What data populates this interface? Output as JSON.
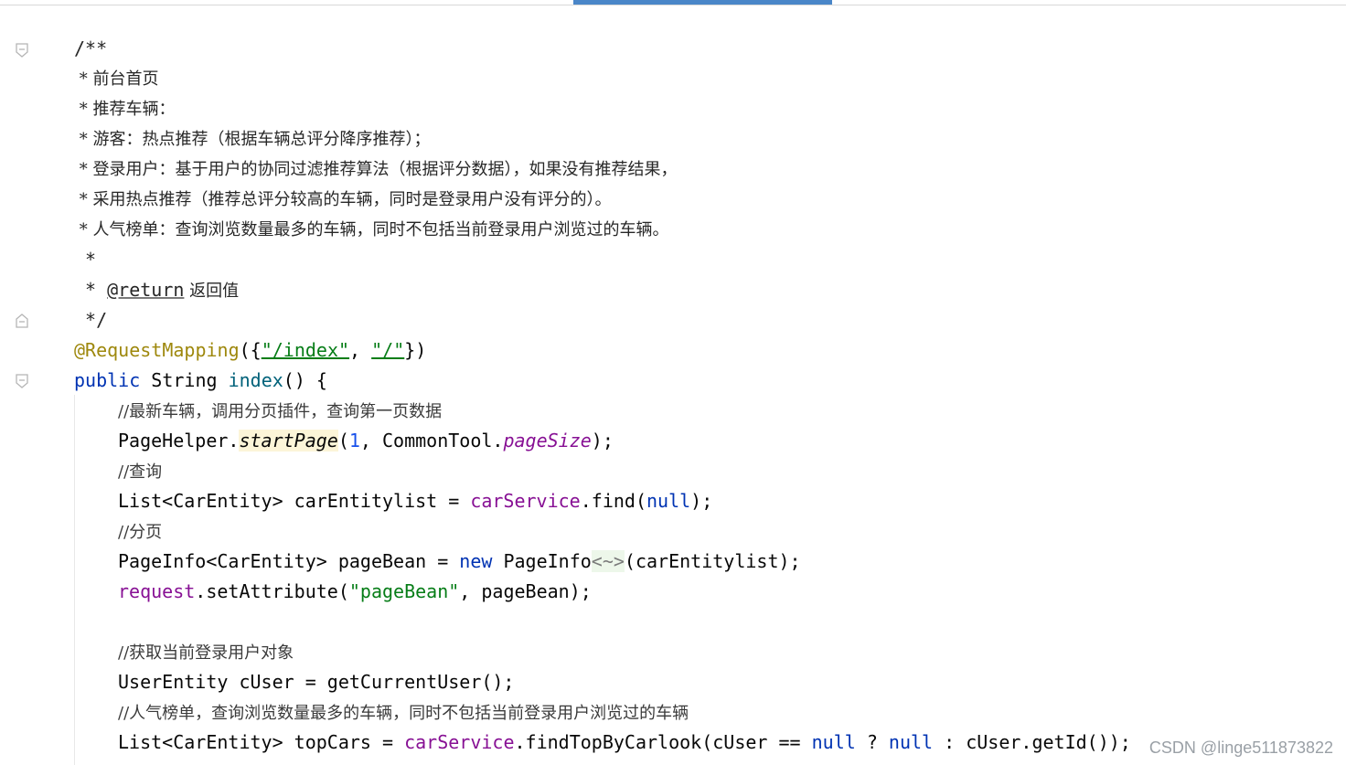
{
  "editor": {
    "watermark": "CSDN @linge511873822"
  },
  "doc_comment": {
    "open": "/**",
    "lines": [
      " * 前台首页",
      " * 推荐车辆：",
      " * 游客：热点推荐（根据车辆总评分降序推荐）；",
      " * 登录用户：基于用户的协同过滤推荐算法（根据评分数据），如果没有推荐结果，",
      " * 采用热点推荐（推荐总评分较高的车辆，同时是登录用户没有评分的）。",
      " * 人气榜单：查询浏览数量最多的车辆，同时不包括当前登录用户浏览过的车辆。",
      " *"
    ],
    "return_star": " * ",
    "return_tag": "@return",
    "return_desc": " 返回值",
    "close": " */"
  },
  "annotation": {
    "name": "@RequestMapping",
    "open": "({",
    "path1": "\"/index\"",
    "sep": ", ",
    "path2": "\"/\"",
    "close": "})"
  },
  "method": {
    "kw_public": "public",
    "type": " String ",
    "name": "index",
    "rest": "() {"
  },
  "body": {
    "c1": "//最新车辆，调用分页插件，查询第一页数据",
    "l1_a": "PageHelper.",
    "l1_b": "startPage",
    "l1_c": "(",
    "l1_d": "1",
    "l1_e": ", CommonTool.",
    "l1_f": "pageSize",
    "l1_g": ");",
    "c2": "//查询",
    "l2_a": "List<CarEntity> carEntitylist = ",
    "l2_b": "carService",
    "l2_c": ".find(",
    "l2_d": "null",
    "l2_e": ");",
    "c3": "//分页",
    "l3_a": "PageInfo<CarEntity> pageBean = ",
    "l3_b": "new",
    "l3_c": " PageInfo",
    "l3_d": "<~>",
    "l3_e": "(carEntitylist);",
    "l4_a": "request",
    "l4_b": ".setAttribute(",
    "l4_c": "\"pageBean\"",
    "l4_d": ", pageBean);",
    "c4": "//获取当前登录用户对象",
    "l5": "UserEntity cUser = getCurrentUser();",
    "c5": "//人气榜单，查询浏览数量最多的车辆，同时不包括当前登录用户浏览过的车辆",
    "l6_a": "List<CarEntity> topCars = ",
    "l6_b": "carService",
    "l6_c": ".findTopByCarlook(cUser == ",
    "l6_d": "null",
    "l6_e": " ? ",
    "l6_f": "null",
    "l6_g": " : cUser.getId());"
  }
}
